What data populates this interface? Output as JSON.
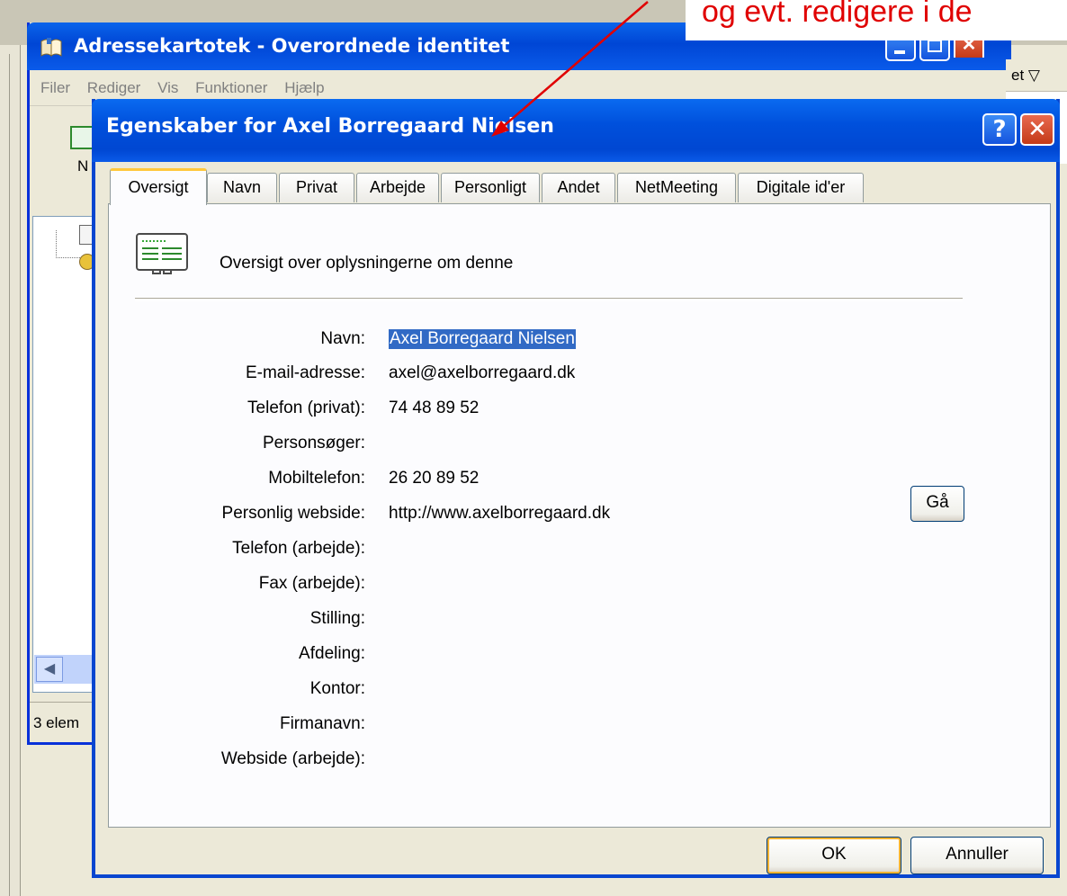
{
  "annotation": {
    "text": "og evt. redigere i de",
    "color": "#E00000"
  },
  "background_window": {
    "title": "Adressekartotek - Overordnede identitet",
    "menu": [
      "Filer",
      "Rediger",
      "Vis",
      "Funktioner",
      "Hjælp"
    ],
    "toolbar_label": "N",
    "status": "3 elem",
    "right_strip_text": "et ▽",
    "titlebar_color": "#0046D5"
  },
  "dialog": {
    "title": "Egenskaber for Axel Borregaard Nielsen",
    "help_glyph": "?",
    "close_glyph": "✕",
    "tabs": [
      "Oversigt",
      "Navn",
      "Privat",
      "Arbejde",
      "Personligt",
      "Andet",
      "NetMeeting",
      "Digitale id'er"
    ],
    "active_tab": "Oversigt",
    "heading": "Oversigt over oplysningerne om denne",
    "fields": [
      {
        "label": "Navn:",
        "value": "Axel Borregaard Nielsen"
      },
      {
        "label": "E-mail-adresse:",
        "value": "axel@axelborregaard.dk"
      },
      {
        "label": "Telefon (privat):",
        "value": "74 48 89 52"
      },
      {
        "label": "Personsøger:",
        "value": ""
      },
      {
        "label": "Mobiltelefon:",
        "value": "26 20 89 52"
      },
      {
        "label": "Personlig webside:",
        "value": "http://www.axelborregaard.dk"
      },
      {
        "label": "Telefon (arbejde):",
        "value": ""
      },
      {
        "label": "Fax (arbejde):",
        "value": ""
      },
      {
        "label": "Stilling:",
        "value": ""
      },
      {
        "label": "Afdeling:",
        "value": ""
      },
      {
        "label": "Kontor:",
        "value": ""
      },
      {
        "label": "Firmanavn:",
        "value": ""
      },
      {
        "label": "Webside (arbejde):",
        "value": ""
      }
    ],
    "go_label": "Gå",
    "ok_label": "OK",
    "cancel_label": "Annuller",
    "selection_color": "#316AC5",
    "active_tab_accent": "#FFC83C"
  }
}
